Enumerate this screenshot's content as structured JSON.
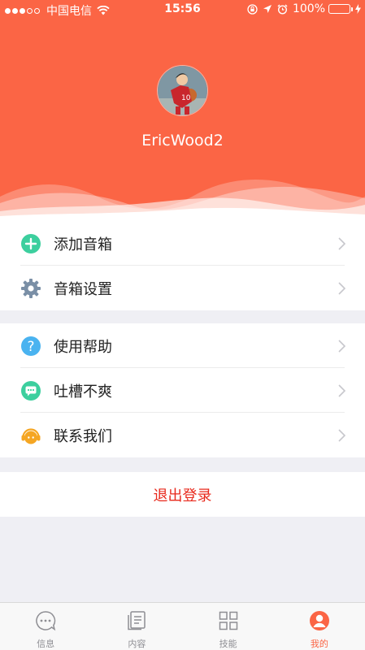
{
  "status_bar": {
    "carrier": "中国电信",
    "time": "15:56",
    "battery": "100%",
    "battery_level": 1.0
  },
  "profile": {
    "username": "EricWood2"
  },
  "menu_group_1": [
    {
      "label": "添加音箱",
      "icon": "plus-circle-icon",
      "color": "#3ccf9e"
    },
    {
      "label": "音箱设置",
      "icon": "gear-icon",
      "color": "#7a8fa6"
    }
  ],
  "menu_group_2": [
    {
      "label": "使用帮助",
      "icon": "question-circle-icon",
      "color": "#4ab3f0"
    },
    {
      "label": "吐槽不爽",
      "icon": "chat-bubble-icon",
      "color": "#3ccf9e"
    },
    {
      "label": "联系我们",
      "icon": "headset-icon",
      "color": "#f5a623"
    }
  ],
  "logout_label": "退出登录",
  "tabs": [
    {
      "label": "信息",
      "icon": "chat-icon",
      "active": false
    },
    {
      "label": "内容",
      "icon": "document-icon",
      "active": false
    },
    {
      "label": "技能",
      "icon": "grid-icon",
      "active": false
    },
    {
      "label": "我的",
      "icon": "profile-icon",
      "active": true
    }
  ],
  "colors": {
    "accent": "#fb6545",
    "logout": "#e8291c",
    "background": "#efeff4"
  }
}
